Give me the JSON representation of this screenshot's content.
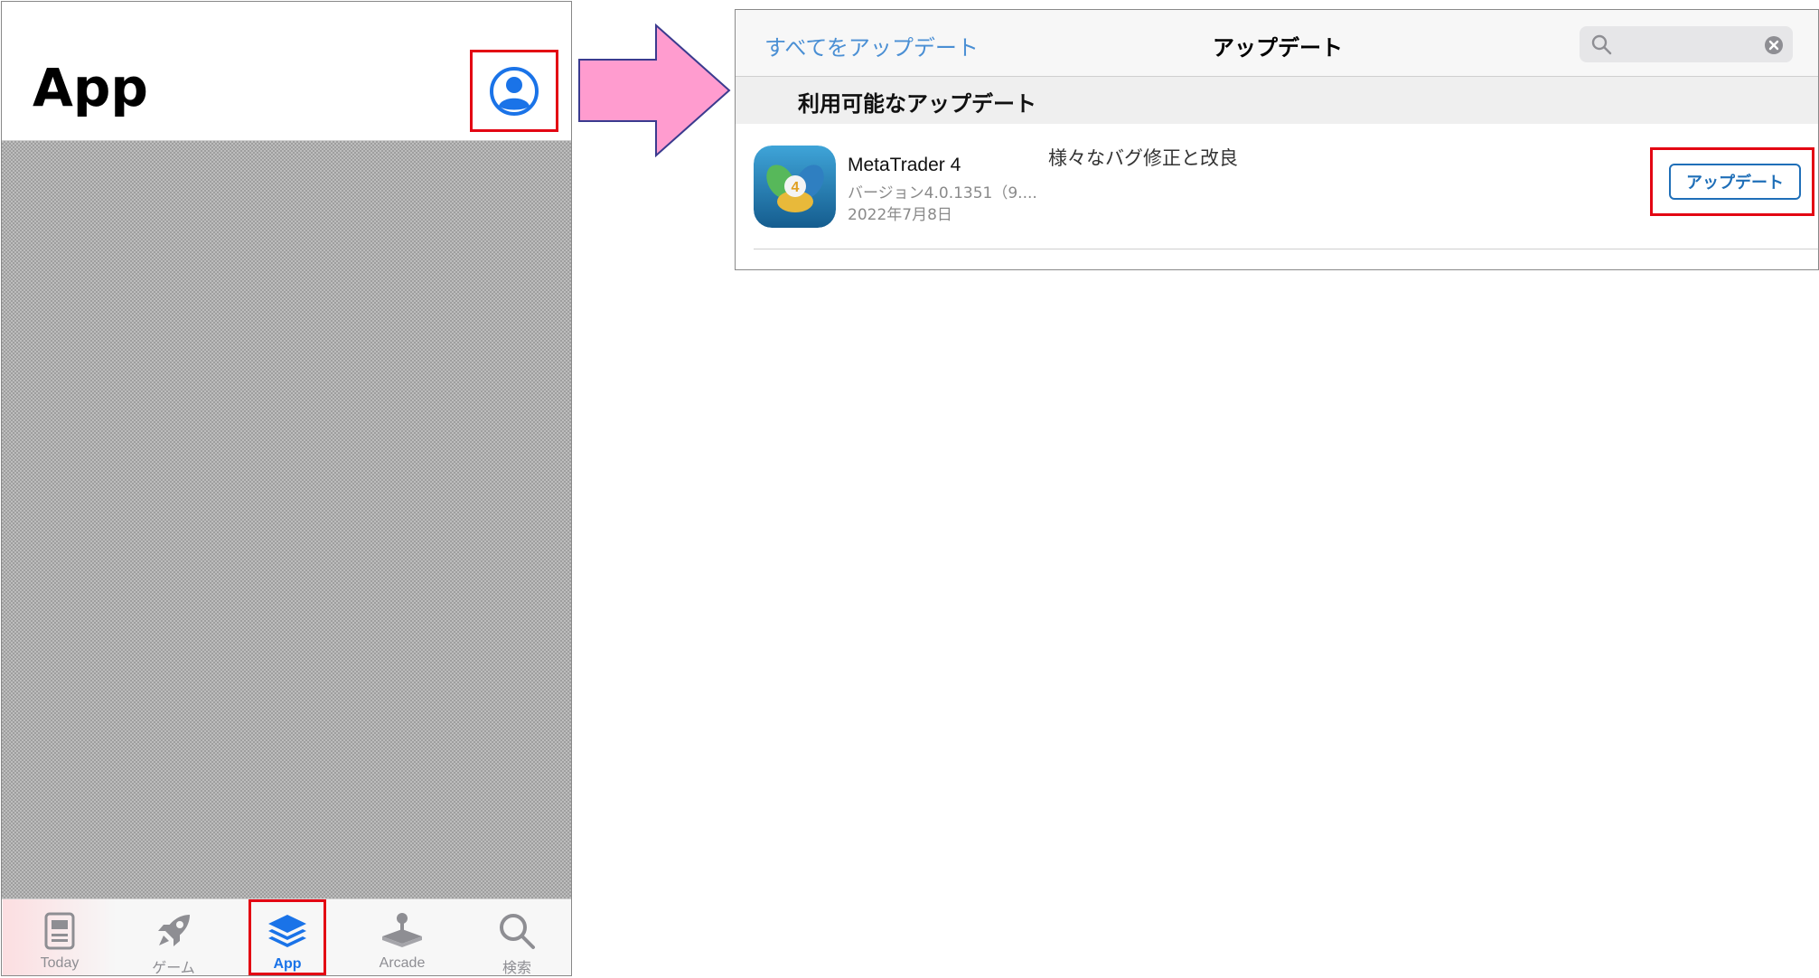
{
  "phone": {
    "title": "App",
    "tabs": [
      {
        "label": "Today",
        "icon": "today-icon"
      },
      {
        "label": "ゲーム",
        "icon": "rocket-icon"
      },
      {
        "label": "App",
        "icon": "app-stack-icon"
      },
      {
        "label": "Arcade",
        "icon": "arcade-joystick-icon"
      },
      {
        "label": "検索",
        "icon": "search-icon"
      }
    ],
    "selected_tab": "App"
  },
  "updates": {
    "update_all_label": "すべてをアップデート",
    "title": "アップデート",
    "search_placeholder": "",
    "section_title": "利用可能なアップデート",
    "item": {
      "name": "MetaTrader 4",
      "version": "バージョン4.0.1351（9....",
      "date": "2022年7月8日",
      "notes": "様々なバグ修正と改良",
      "button_label": "アップデート"
    }
  },
  "colors": {
    "accent_blue": "#1f6fb8",
    "highlight_red": "#e30613",
    "arrow_pink": "#ff9ccf"
  }
}
